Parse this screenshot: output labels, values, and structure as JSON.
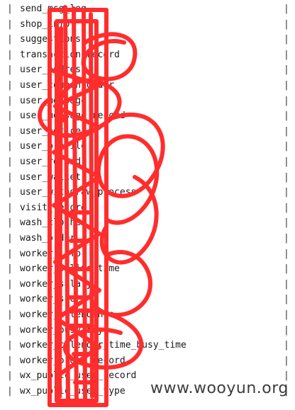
{
  "table": {
    "rows": [
      "send_msg_log",
      "shop_info",
      "suggestions",
      "transaction_record",
      "user_address",
      "user_coupon_order",
      "user_message",
      "user_message_record",
      "user_notice",
      "user_profile",
      "user_refund",
      "user_wallet",
      "user_withdraw_process",
      "visit_record",
      "wash_clothes",
      "wash_order",
      "worker_info",
      "worker_online_time",
      "worker_salary",
      "worker_score",
      "worker_attendance",
      "worker_busy_day",
      "worker_calendar_time_busy_time",
      "worker_order_record",
      "wx_public_user_record",
      "wx_public_user_type"
    ]
  },
  "colors": {
    "scribble": "#ff2d2d",
    "text": "#1a1a1a",
    "background": "#ffffff"
  },
  "watermark": {
    "text": "www.wooyun.org"
  }
}
